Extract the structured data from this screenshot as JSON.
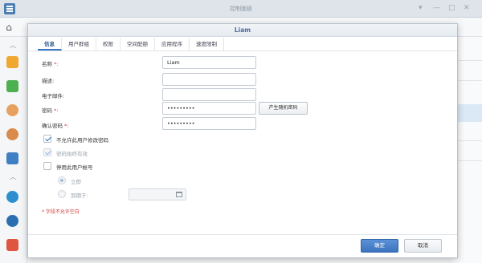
{
  "window": {
    "title": "控制面板"
  },
  "dialog": {
    "title": "Liam",
    "tabs": [
      "信息",
      "用户群组",
      "权限",
      "空间配额",
      "应用程序",
      "速度限制"
    ],
    "fields": {
      "name": {
        "label": "名称",
        "value": "Liam"
      },
      "description": {
        "label": "描述:",
        "value": ""
      },
      "email": {
        "label": "电子邮件:",
        "value": ""
      },
      "password": {
        "label": "密码",
        "value": "•••••••••"
      },
      "confirm": {
        "label": "确认密码",
        "value": "•••••••••"
      },
      "required_mark": "*:"
    },
    "generate_button": "产生随机密码",
    "options": {
      "disallow_change": "不允许此用户修改密码",
      "password_always_valid": "密码始终有效",
      "disable_account": "停用此用户帐号",
      "immediately": "立即",
      "expire_on": "到期于:"
    },
    "note": "* 字段不允许空白",
    "ok_button": "确定",
    "cancel_button": "取消"
  },
  "colors": {
    "accent": "#3b73bf",
    "required": "#d03a3a"
  }
}
